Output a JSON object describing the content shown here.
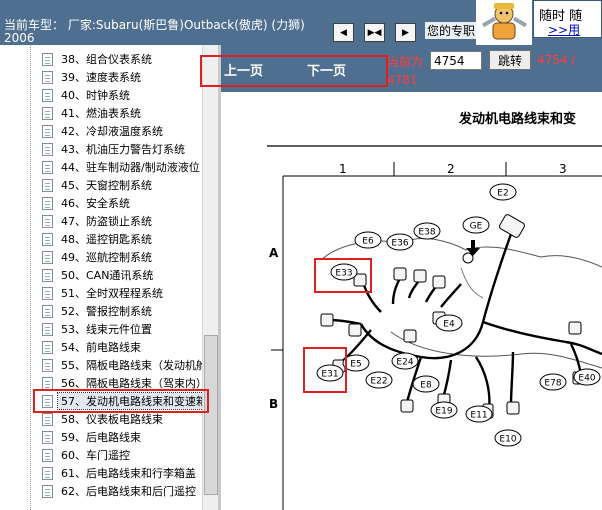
{
  "header": {
    "car_info": "当前车型： 厂家:Subaru(斯巴鲁)Outback(傲虎)  (力狮) 2006",
    "ad_text": "您的专职",
    "ad_box_line1": "随时 随",
    "ad_box_line2": ">>用"
  },
  "tree": {
    "items": [
      "38、组合仪表系统",
      "39、速度表系统",
      "40、时钟系统",
      "41、燃油表系统",
      "42、冷却液温度系统",
      "43、机油压力警告灯系统",
      "44、驻车制动器/制动液液位",
      "45、天窗控制系统",
      "46、安全系统",
      "47、防盗锁止系统",
      "48、遥控钥匙系统",
      "49、巡航控制系统",
      "50、CAN通讯系统",
      "51、全时双程程系统",
      "52、警报控制系统",
      "53、线束元件位置",
      "54、前电路线束",
      "55、隔板电路线束（发动机舱",
      "56、隔板电路线束（驾束内）",
      "57、发动机电路线束和变速箱",
      "58、仪表板电路线束",
      "59、后电路线束",
      "60、车门遥控",
      "61、后电路线束和行李箱盖",
      "62、后电路线束和后门遥控"
    ],
    "selected_index": 19
  },
  "pager": {
    "prev": "上一页",
    "next": "下一页",
    "current_label": "当前为",
    "current_value": "4754",
    "go": "跳转",
    "total_a": "4754 /",
    "total_b": "4781"
  },
  "diagram": {
    "title": "发动机电路线束和变",
    "col_labels": [
      "1",
      "2",
      "3"
    ],
    "row_labels": [
      "A",
      "B"
    ],
    "connectors": [
      "E2",
      "GE",
      "E6",
      "E36",
      "E38",
      "E33",
      "E4",
      "E5",
      "E24",
      "E22",
      "E31",
      "E8",
      "E19",
      "E11",
      "E10",
      "E78",
      "E40"
    ]
  },
  "colors": {
    "header_bg": "#4f6f91",
    "pager_text": "#ff3c3c",
    "highlight": "#e02020"
  }
}
